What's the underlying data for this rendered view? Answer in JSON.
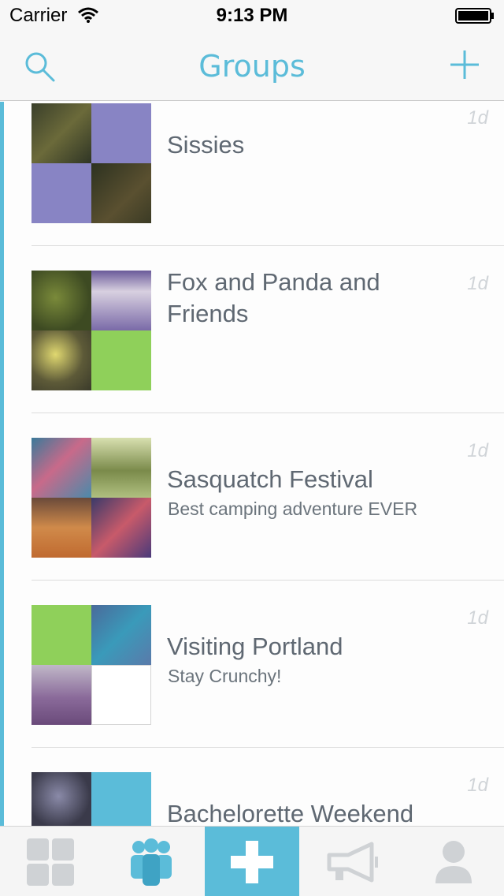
{
  "status_bar": {
    "carrier": "Carrier",
    "time": "9:13 PM"
  },
  "nav": {
    "title": "Groups",
    "search_icon": "search-icon",
    "add_icon": "plus-icon"
  },
  "colors": {
    "accent": "#5bbcd9",
    "green": "#8fd05a",
    "purple": "#8884c4"
  },
  "groups": [
    {
      "title": "Sissies",
      "subtitle": "",
      "time": "1d"
    },
    {
      "title": "Fox and Panda and Friends",
      "subtitle": "",
      "time": "1d"
    },
    {
      "title": "Sasquatch Festival",
      "subtitle": "Best camping adventure EVER",
      "time": "1d"
    },
    {
      "title": "Visiting Portland",
      "subtitle": "Stay Crunchy!",
      "time": "1d"
    },
    {
      "title": "Bachelorette Weekend",
      "subtitle": "",
      "time": "1d"
    }
  ],
  "tabs": [
    {
      "icon": "grid-icon",
      "active": false
    },
    {
      "icon": "group-icon",
      "active": true
    },
    {
      "icon": "plus-icon",
      "active": false
    },
    {
      "icon": "megaphone-icon",
      "active": false
    },
    {
      "icon": "profile-icon",
      "active": false
    }
  ]
}
